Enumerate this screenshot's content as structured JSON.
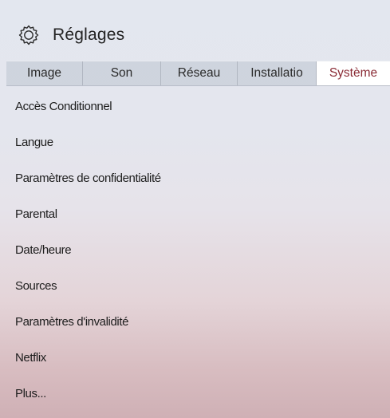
{
  "header": {
    "title": "Réglages",
    "icon": "gear-icon"
  },
  "tabs": [
    {
      "label": "Image",
      "active": false
    },
    {
      "label": "Son",
      "active": false
    },
    {
      "label": "Réseau",
      "active": false
    },
    {
      "label": "Installatio",
      "active": false
    },
    {
      "label": "Système",
      "active": true
    }
  ],
  "menu": {
    "items": [
      {
        "label": "Accès Conditionnel"
      },
      {
        "label": "Langue"
      },
      {
        "label": "Paramètres de confidentialité"
      },
      {
        "label": "Parental"
      },
      {
        "label": "Date/heure"
      },
      {
        "label": "Sources"
      },
      {
        "label": "Paramètres d'invalidité"
      },
      {
        "label": "Netflix"
      },
      {
        "label": "Plus..."
      }
    ]
  },
  "colors": {
    "active_tab_text": "#8a2b35",
    "active_tab_background": "#ffffff",
    "tab_bar_background": "#c4c9d3"
  }
}
